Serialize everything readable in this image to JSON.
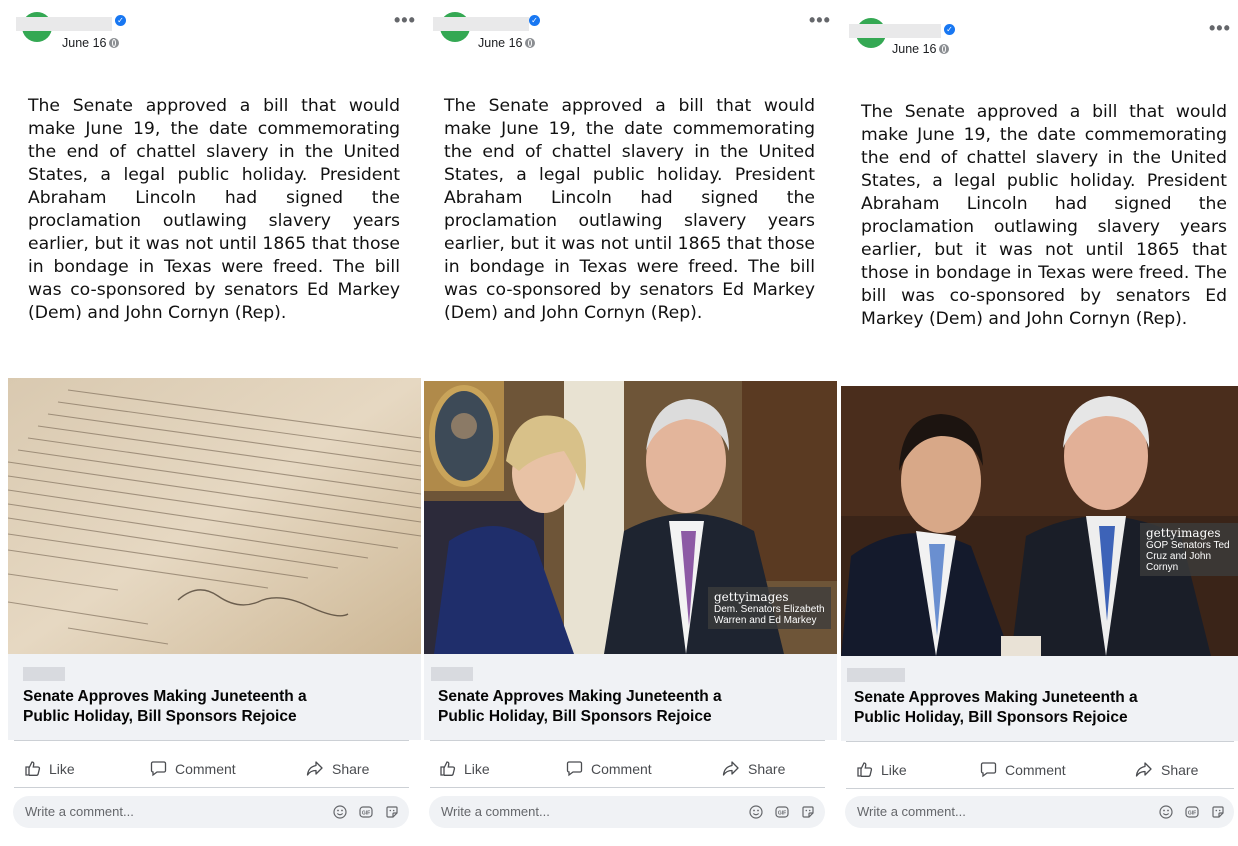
{
  "posts": [
    {
      "date": "June 16",
      "body": "The Senate approved a bill that would make June 19, the date commemorating the end of chattel slavery in the United States, a legal public holiday. President Abraham Lincoln had signed the proclamation outlawing slavery years earlier, but it was not until 1865 that those in bondage in Texas were freed. The bill was co-sponsored by senators Ed Markey (Dem) and John Cornyn (Rep).",
      "photo_logo": "",
      "photo_caption": "",
      "headline": "Senate Approves Making Juneteenth a Public Holiday, Bill Sponsors Rejoice",
      "like_label": "Like",
      "comment_label": "Comment",
      "share_label": "Share",
      "comment_placeholder": "Write a comment..."
    },
    {
      "date": "June 16",
      "body": "The Senate approved a bill that would make June 19, the date commemorating the end of chattel slavery in the United States, a legal public holiday. President Abraham Lincoln had signed the proclamation outlawing slavery years earlier, but it was not until 1865 that those in bondage in Texas were freed. The bill was co-sponsored by senators Ed Markey (Dem) and John Cornyn (Rep).",
      "photo_logo": "gettyimages",
      "photo_caption": "Dem. Senators Elizabeth Warren and Ed Markey",
      "headline": "Senate Approves Making Juneteenth a Public Holiday, Bill Sponsors Rejoice",
      "like_label": "Like",
      "comment_label": "Comment",
      "share_label": "Share",
      "comment_placeholder": "Write a comment..."
    },
    {
      "date": "June 16",
      "body": "The Senate approved a bill that would make June 19, the date commemorating the end of chattel slavery in the United States, a legal public holiday. President Abraham Lincoln had signed the proclamation outlawing slavery years earlier, but it was not until 1865 that those in bondage in Texas were freed. The bill was co-sponsored by senators Ed Markey (Dem) and John Cornyn (Rep).",
      "photo_logo": "gettyimages",
      "photo_caption": "GOP Senators Ted Cruz and John Cornyn",
      "headline": "Senate Approves Making Juneteenth a Public Holiday, Bill Sponsors Rejoice",
      "like_label": "Like",
      "comment_label": "Comment",
      "share_label": "Share",
      "comment_placeholder": "Write a comment..."
    }
  ],
  "colors": {
    "avatar": "#34a853",
    "verified": "#1877f2",
    "card_bg": "#f0f2f5"
  },
  "icons": [
    "avatar",
    "verified-icon",
    "globe-icon",
    "more-icon",
    "like-icon",
    "comment-icon",
    "share-icon",
    "emoji-icon",
    "gif-icon",
    "sticker-icon"
  ]
}
